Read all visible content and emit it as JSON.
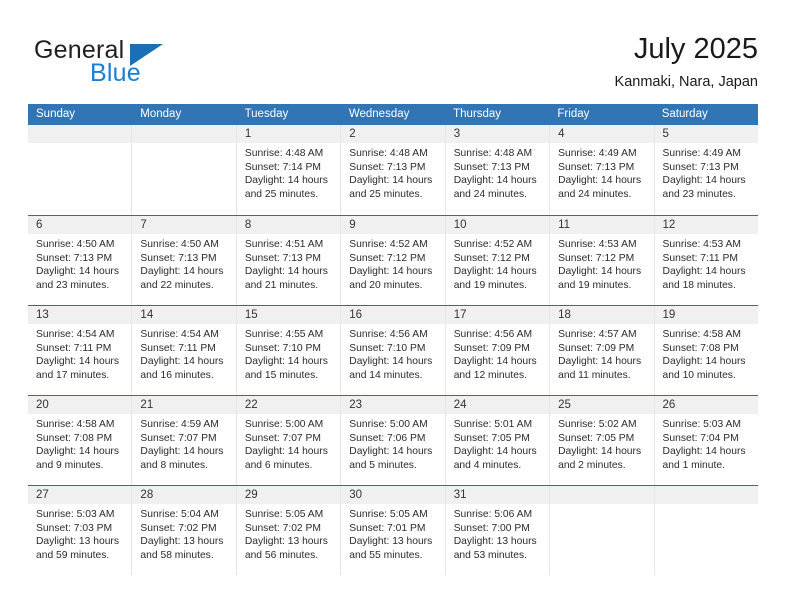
{
  "logo": {
    "word_one": "General",
    "word_two": "Blue",
    "triangle_color": "#1a6fb5",
    "blue_color": "#1a7fd4"
  },
  "header": {
    "title": "July 2025",
    "subtitle": "Kanmaki, Nara, Japan"
  },
  "theme": {
    "header_blue": "#3275b4",
    "rule_blue": "#2e6da4",
    "daynum_band": "#f0f0f0"
  },
  "weekdays": [
    "Sunday",
    "Monday",
    "Tuesday",
    "Wednesday",
    "Thursday",
    "Friday",
    "Saturday"
  ],
  "weeks": [
    [
      {
        "day": "",
        "sunrise": "",
        "sunset": "",
        "daylight_a": "",
        "daylight_b": "",
        "empty": true
      },
      {
        "day": "",
        "sunrise": "",
        "sunset": "",
        "daylight_a": "",
        "daylight_b": "",
        "empty": true
      },
      {
        "day": "1",
        "sunrise": "Sunrise: 4:48 AM",
        "sunset": "Sunset: 7:14 PM",
        "daylight_a": "Daylight: 14 hours",
        "daylight_b": "and 25 minutes."
      },
      {
        "day": "2",
        "sunrise": "Sunrise: 4:48 AM",
        "sunset": "Sunset: 7:13 PM",
        "daylight_a": "Daylight: 14 hours",
        "daylight_b": "and 25 minutes."
      },
      {
        "day": "3",
        "sunrise": "Sunrise: 4:48 AM",
        "sunset": "Sunset: 7:13 PM",
        "daylight_a": "Daylight: 14 hours",
        "daylight_b": "and 24 minutes."
      },
      {
        "day": "4",
        "sunrise": "Sunrise: 4:49 AM",
        "sunset": "Sunset: 7:13 PM",
        "daylight_a": "Daylight: 14 hours",
        "daylight_b": "and 24 minutes."
      },
      {
        "day": "5",
        "sunrise": "Sunrise: 4:49 AM",
        "sunset": "Sunset: 7:13 PM",
        "daylight_a": "Daylight: 14 hours",
        "daylight_b": "and 23 minutes."
      }
    ],
    [
      {
        "day": "6",
        "sunrise": "Sunrise: 4:50 AM",
        "sunset": "Sunset: 7:13 PM",
        "daylight_a": "Daylight: 14 hours",
        "daylight_b": "and 23 minutes."
      },
      {
        "day": "7",
        "sunrise": "Sunrise: 4:50 AM",
        "sunset": "Sunset: 7:13 PM",
        "daylight_a": "Daylight: 14 hours",
        "daylight_b": "and 22 minutes."
      },
      {
        "day": "8",
        "sunrise": "Sunrise: 4:51 AM",
        "sunset": "Sunset: 7:13 PM",
        "daylight_a": "Daylight: 14 hours",
        "daylight_b": "and 21 minutes."
      },
      {
        "day": "9",
        "sunrise": "Sunrise: 4:52 AM",
        "sunset": "Sunset: 7:12 PM",
        "daylight_a": "Daylight: 14 hours",
        "daylight_b": "and 20 minutes."
      },
      {
        "day": "10",
        "sunrise": "Sunrise: 4:52 AM",
        "sunset": "Sunset: 7:12 PM",
        "daylight_a": "Daylight: 14 hours",
        "daylight_b": "and 19 minutes."
      },
      {
        "day": "11",
        "sunrise": "Sunrise: 4:53 AM",
        "sunset": "Sunset: 7:12 PM",
        "daylight_a": "Daylight: 14 hours",
        "daylight_b": "and 19 minutes."
      },
      {
        "day": "12",
        "sunrise": "Sunrise: 4:53 AM",
        "sunset": "Sunset: 7:11 PM",
        "daylight_a": "Daylight: 14 hours",
        "daylight_b": "and 18 minutes."
      }
    ],
    [
      {
        "day": "13",
        "sunrise": "Sunrise: 4:54 AM",
        "sunset": "Sunset: 7:11 PM",
        "daylight_a": "Daylight: 14 hours",
        "daylight_b": "and 17 minutes."
      },
      {
        "day": "14",
        "sunrise": "Sunrise: 4:54 AM",
        "sunset": "Sunset: 7:11 PM",
        "daylight_a": "Daylight: 14 hours",
        "daylight_b": "and 16 minutes."
      },
      {
        "day": "15",
        "sunrise": "Sunrise: 4:55 AM",
        "sunset": "Sunset: 7:10 PM",
        "daylight_a": "Daylight: 14 hours",
        "daylight_b": "and 15 minutes."
      },
      {
        "day": "16",
        "sunrise": "Sunrise: 4:56 AM",
        "sunset": "Sunset: 7:10 PM",
        "daylight_a": "Daylight: 14 hours",
        "daylight_b": "and 14 minutes."
      },
      {
        "day": "17",
        "sunrise": "Sunrise: 4:56 AM",
        "sunset": "Sunset: 7:09 PM",
        "daylight_a": "Daylight: 14 hours",
        "daylight_b": "and 12 minutes."
      },
      {
        "day": "18",
        "sunrise": "Sunrise: 4:57 AM",
        "sunset": "Sunset: 7:09 PM",
        "daylight_a": "Daylight: 14 hours",
        "daylight_b": "and 11 minutes."
      },
      {
        "day": "19",
        "sunrise": "Sunrise: 4:58 AM",
        "sunset": "Sunset: 7:08 PM",
        "daylight_a": "Daylight: 14 hours",
        "daylight_b": "and 10 minutes."
      }
    ],
    [
      {
        "day": "20",
        "sunrise": "Sunrise: 4:58 AM",
        "sunset": "Sunset: 7:08 PM",
        "daylight_a": "Daylight: 14 hours",
        "daylight_b": "and 9 minutes."
      },
      {
        "day": "21",
        "sunrise": "Sunrise: 4:59 AM",
        "sunset": "Sunset: 7:07 PM",
        "daylight_a": "Daylight: 14 hours",
        "daylight_b": "and 8 minutes."
      },
      {
        "day": "22",
        "sunrise": "Sunrise: 5:00 AM",
        "sunset": "Sunset: 7:07 PM",
        "daylight_a": "Daylight: 14 hours",
        "daylight_b": "and 6 minutes."
      },
      {
        "day": "23",
        "sunrise": "Sunrise: 5:00 AM",
        "sunset": "Sunset: 7:06 PM",
        "daylight_a": "Daylight: 14 hours",
        "daylight_b": "and 5 minutes."
      },
      {
        "day": "24",
        "sunrise": "Sunrise: 5:01 AM",
        "sunset": "Sunset: 7:05 PM",
        "daylight_a": "Daylight: 14 hours",
        "daylight_b": "and 4 minutes."
      },
      {
        "day": "25",
        "sunrise": "Sunrise: 5:02 AM",
        "sunset": "Sunset: 7:05 PM",
        "daylight_a": "Daylight: 14 hours",
        "daylight_b": "and 2 minutes."
      },
      {
        "day": "26",
        "sunrise": "Sunrise: 5:03 AM",
        "sunset": "Sunset: 7:04 PM",
        "daylight_a": "Daylight: 14 hours",
        "daylight_b": "and 1 minute."
      }
    ],
    [
      {
        "day": "27",
        "sunrise": "Sunrise: 5:03 AM",
        "sunset": "Sunset: 7:03 PM",
        "daylight_a": "Daylight: 13 hours",
        "daylight_b": "and 59 minutes."
      },
      {
        "day": "28",
        "sunrise": "Sunrise: 5:04 AM",
        "sunset": "Sunset: 7:02 PM",
        "daylight_a": "Daylight: 13 hours",
        "daylight_b": "and 58 minutes."
      },
      {
        "day": "29",
        "sunrise": "Sunrise: 5:05 AM",
        "sunset": "Sunset: 7:02 PM",
        "daylight_a": "Daylight: 13 hours",
        "daylight_b": "and 56 minutes."
      },
      {
        "day": "30",
        "sunrise": "Sunrise: 5:05 AM",
        "sunset": "Sunset: 7:01 PM",
        "daylight_a": "Daylight: 13 hours",
        "daylight_b": "and 55 minutes."
      },
      {
        "day": "31",
        "sunrise": "Sunrise: 5:06 AM",
        "sunset": "Sunset: 7:00 PM",
        "daylight_a": "Daylight: 13 hours",
        "daylight_b": "and 53 minutes."
      },
      {
        "day": "",
        "sunrise": "",
        "sunset": "",
        "daylight_a": "",
        "daylight_b": "",
        "empty": true
      },
      {
        "day": "",
        "sunrise": "",
        "sunset": "",
        "daylight_a": "",
        "daylight_b": "",
        "empty": true
      }
    ]
  ]
}
